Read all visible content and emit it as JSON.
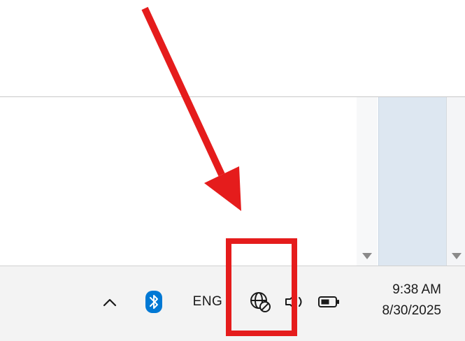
{
  "taskbar": {
    "language": "ENG",
    "clock": {
      "time": "9:38 AM",
      "date": "8/30/2025"
    }
  },
  "tray_icons": [
    "chevron-up-icon",
    "bluetooth-icon",
    "network-no-internet-icon",
    "volume-icon",
    "battery-icon"
  ],
  "annotation": {
    "color": "#e51c1c"
  },
  "colors": {
    "bluetooth": "#0078d4",
    "taskbar_bg": "#f3f3f3",
    "selected_column": "#dde7f1"
  }
}
